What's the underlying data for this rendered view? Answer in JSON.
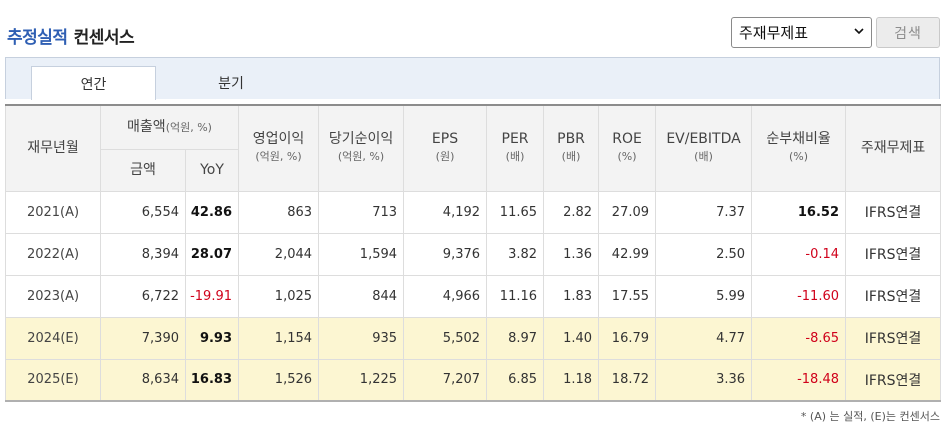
{
  "title": {
    "main": "추정실적",
    "sub": "컨센서스"
  },
  "controls": {
    "select_value": "주재무제표",
    "search_label": "검색"
  },
  "tabs": [
    {
      "label": "연간",
      "active": true
    },
    {
      "label": "분기",
      "active": false
    }
  ],
  "headers": {
    "year": "재무년월",
    "sales": "매출액",
    "sales_unit": "(억원, %)",
    "amount": "금액",
    "yoy": "YoY",
    "op_income": "영업이익",
    "op_income_unit": "(억원, %)",
    "net_income": "당기순이익",
    "net_income_unit": "(억원, %)",
    "eps": "EPS",
    "eps_unit": "(원)",
    "per": "PER",
    "per_unit": "(배)",
    "pbr": "PBR",
    "pbr_unit": "(배)",
    "roe": "ROE",
    "roe_unit": "(%)",
    "ev": "EV/EBITDA",
    "ev_unit": "(배)",
    "debt": "순부채비율",
    "debt_unit": "(%)",
    "fs": "주재무제표"
  },
  "rows": [
    {
      "year": "2021(A)",
      "amount": "6,554",
      "yoy": "42.86",
      "op": "863",
      "net": "713",
      "eps": "4,192",
      "per": "11.65",
      "pbr": "2.82",
      "roe": "27.09",
      "ev": "7.37",
      "debt": "16.52",
      "fs": "IFRS연결"
    },
    {
      "year": "2022(A)",
      "amount": "8,394",
      "yoy": "28.07",
      "op": "2,044",
      "net": "1,594",
      "eps": "9,376",
      "per": "3.82",
      "pbr": "1.36",
      "roe": "42.99",
      "ev": "2.50",
      "debt": "-0.14",
      "fs": "IFRS연결"
    },
    {
      "year": "2023(A)",
      "amount": "6,722",
      "yoy": "-19.91",
      "op": "1,025",
      "net": "844",
      "eps": "4,966",
      "per": "11.16",
      "pbr": "1.83",
      "roe": "17.55",
      "ev": "5.99",
      "debt": "-11.60",
      "fs": "IFRS연결"
    },
    {
      "year": "2024(E)",
      "amount": "7,390",
      "yoy": "9.93",
      "op": "1,154",
      "net": "935",
      "eps": "5,502",
      "per": "8.97",
      "pbr": "1.40",
      "roe": "16.79",
      "ev": "4.77",
      "debt": "-8.65",
      "fs": "IFRS연결"
    },
    {
      "year": "2025(E)",
      "amount": "8,634",
      "yoy": "16.83",
      "op": "1,526",
      "net": "1,225",
      "eps": "7,207",
      "per": "6.85",
      "pbr": "1.18",
      "roe": "18.72",
      "ev": "3.36",
      "debt": "-18.48",
      "fs": "IFRS연결"
    }
  ],
  "footnote": "* (A) 는 실적, (E)는 컨센서스",
  "colors": {
    "title_blue": "#2f5fb3",
    "negative": "#d0021b",
    "estimate_row": "#fcf6d2"
  }
}
